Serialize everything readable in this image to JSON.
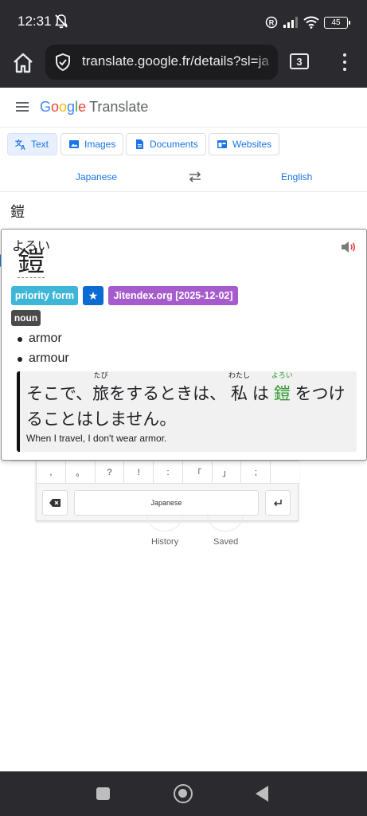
{
  "status_bar": {
    "time": "12:31",
    "battery": "45"
  },
  "browser": {
    "url": "translate.google.fr/details?sl=ja",
    "tab_count": "3"
  },
  "translate_header": {
    "logo_letters": [
      "G",
      "o",
      "o",
      "g",
      "l",
      "e"
    ],
    "product_name": "Translate"
  },
  "modes": [
    {
      "label": "Text",
      "icon": "translate-icon",
      "active": true
    },
    {
      "label": "Images",
      "icon": "image-icon",
      "active": false
    },
    {
      "label": "Documents",
      "icon": "document-icon",
      "active": false
    },
    {
      "label": "Websites",
      "icon": "website-icon",
      "active": false
    }
  ],
  "languages": {
    "source": "Japanese",
    "target": "English"
  },
  "source_text": "鎧",
  "popup": {
    "reading": "よろい",
    "headword": "鎧",
    "tags": {
      "priority": "priority form",
      "star": "★",
      "dictionary": "Jitendex.org [2025-12-02]"
    },
    "part_of_speech": "noun",
    "glosses": [
      "armor",
      "armour"
    ],
    "example": {
      "line1_a": "そこで、",
      "ruby1_base": "旅",
      "ruby1_text": "たび",
      "line1_b": "をするときは、",
      "ruby2_base": "私",
      "ruby2_text": "わたし",
      "line1_c": "は",
      "ruby3_base": "鎧",
      "ruby3_text": "よろい",
      "line1_d": "をつけ",
      "line2": "ることはしません。",
      "translation": "When I travel, I don't wear armor."
    }
  },
  "keyboard": {
    "keys": [
      ",",
      "。",
      "?",
      "!",
      ":",
      "「",
      "」",
      ";",
      ""
    ],
    "space_label": "Japanese"
  },
  "bottom_actions": {
    "history": "History",
    "saved": "Saved"
  },
  "colors": {
    "accent": "#1a73e8",
    "priority_tag": "#3fb6d8",
    "star_tag": "#0a6cd2",
    "dictionary_tag": "#a65ccd",
    "highlight": "#2e9a2e"
  }
}
